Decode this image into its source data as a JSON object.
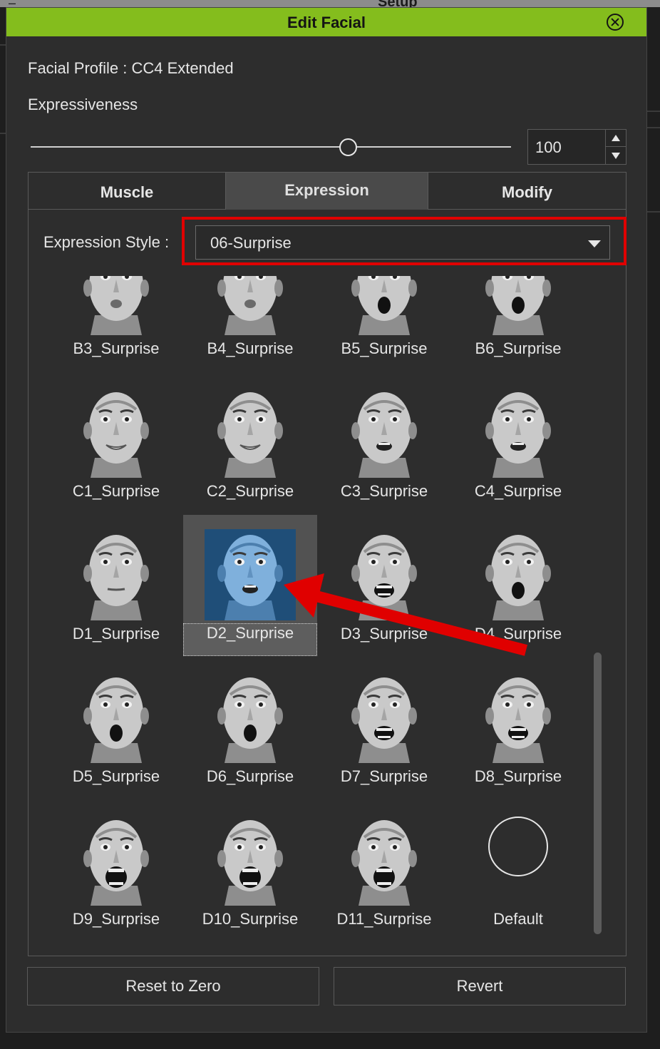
{
  "background": {
    "window_title": "Setup",
    "dash": "–"
  },
  "dialog": {
    "title": "Edit Facial"
  },
  "profile": {
    "label": "Facial Profile : ",
    "value": "CC4 Extended"
  },
  "expressiveness": {
    "label": "Expressiveness",
    "value": "100",
    "slider_fraction": 0.67
  },
  "tabs": [
    {
      "label": "Muscle",
      "active": false
    },
    {
      "label": "Expression",
      "active": true
    },
    {
      "label": "Modify",
      "active": false
    }
  ],
  "expression_style": {
    "label": "Expression Style :",
    "value": "06-Surprise"
  },
  "presets": [
    {
      "label": "B3_Surprise",
      "mouth": "pucker"
    },
    {
      "label": "B4_Surprise",
      "mouth": "pucker"
    },
    {
      "label": "B5_Surprise",
      "mouth": "o"
    },
    {
      "label": "B6_Surprise",
      "mouth": "o"
    },
    {
      "label": "C1_Surprise",
      "mouth": "smile"
    },
    {
      "label": "C2_Surprise",
      "mouth": "smile"
    },
    {
      "label": "C3_Surprise",
      "mouth": "small-open"
    },
    {
      "label": "C4_Surprise",
      "mouth": "small-open"
    },
    {
      "label": "D1_Surprise",
      "mouth": "neutral"
    },
    {
      "label": "D2_Surprise",
      "mouth": "small-open",
      "selected": true
    },
    {
      "label": "D3_Surprise",
      "mouth": "teeth"
    },
    {
      "label": "D4_Surprise",
      "mouth": "o"
    },
    {
      "label": "D5_Surprise",
      "mouth": "o"
    },
    {
      "label": "D6_Surprise",
      "mouth": "o"
    },
    {
      "label": "D7_Surprise",
      "mouth": "teeth"
    },
    {
      "label": "D8_Surprise",
      "mouth": "teeth"
    },
    {
      "label": "D9_Surprise",
      "mouth": "wide"
    },
    {
      "label": "D10_Surprise",
      "mouth": "wide"
    },
    {
      "label": "D11_Surprise",
      "mouth": "wide"
    },
    {
      "label": "Default",
      "mouth": "none"
    }
  ],
  "buttons": {
    "reset": "Reset to Zero",
    "revert": "Revert"
  },
  "colors": {
    "accent": "#84bd1d",
    "highlight": "#e00000",
    "selection": "#4a84b8",
    "panel": "#2d2d2d"
  }
}
